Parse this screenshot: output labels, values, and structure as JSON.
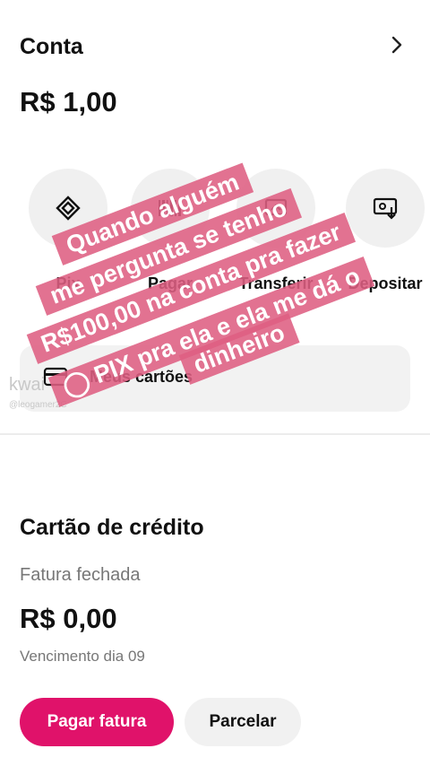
{
  "account": {
    "title": "Conta",
    "balance": "R$ 1,00",
    "actions": [
      {
        "label": "Pix",
        "icon": "pix-icon"
      },
      {
        "label": "Pagar",
        "icon": "barcode-icon"
      },
      {
        "label": "Transferir",
        "icon": "transfer-icon"
      },
      {
        "label": "Depositar",
        "icon": "deposit-icon"
      }
    ],
    "cards_label": "Meus cartões"
  },
  "credit": {
    "title": "Cartão de crédito",
    "status": "Fatura fechada",
    "value": "R$ 0,00",
    "due": "Vencimento dia 09",
    "pay_button": "Pagar fatura",
    "installment_button": "Parcelar"
  },
  "overlay": {
    "lines": [
      "Quando alguém",
      "me pergunta se tenho",
      "R$100,00 na conta pra fazer",
      "◯ PIX pra ela e ela me dá o",
      "dinheiro"
    ]
  },
  "watermark": {
    "brand": "kwai",
    "handle": "@leogamer2C"
  },
  "colors": {
    "accent": "#e0126a",
    "overlay": "#de5f82"
  }
}
